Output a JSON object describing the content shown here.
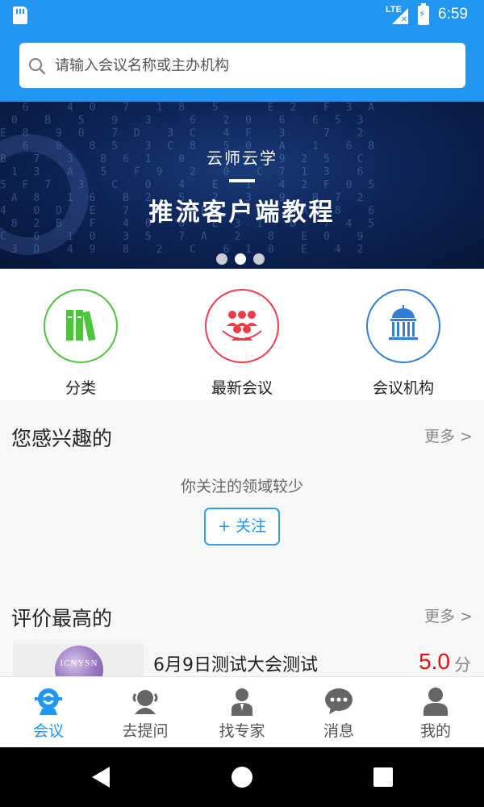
{
  "status": {
    "network": "LTE",
    "time": "6:59"
  },
  "search": {
    "placeholder": "请输入会议名称或主办机构"
  },
  "banner": {
    "subtitle": "云师云学",
    "title": "推流客户端教程",
    "slide_count": 3,
    "active_slide": 1
  },
  "categories": [
    {
      "label": "分类",
      "icon": "books-icon",
      "color": "#4cc43c"
    },
    {
      "label": "最新会议",
      "icon": "audience-icon",
      "color": "#f03a4a"
    },
    {
      "label": "会议机构",
      "icon": "institution-icon",
      "color": "#2f7fd6"
    }
  ],
  "interest": {
    "title": "您感兴趣的",
    "more": "更多 >",
    "empty_text": "你关注的领域较少",
    "follow_label": "+ 关注"
  },
  "top_rated": {
    "title": "评价最高的",
    "more": "更多 >",
    "items": [
      {
        "title": "6月9日测试大会测试",
        "score": "5.0",
        "unit": "分",
        "logo_text": "ICNYSN"
      }
    ]
  },
  "tabs": [
    {
      "label": "会议",
      "icon": "meeting-icon",
      "active": true
    },
    {
      "label": "去提问",
      "icon": "ask-icon",
      "active": false
    },
    {
      "label": "找专家",
      "icon": "expert-icon",
      "active": false
    },
    {
      "label": "消息",
      "icon": "message-icon",
      "active": false
    },
    {
      "label": "我的",
      "icon": "profile-icon",
      "active": false
    }
  ],
  "colors": {
    "primary": "#2196f3",
    "score": "#e01010"
  }
}
